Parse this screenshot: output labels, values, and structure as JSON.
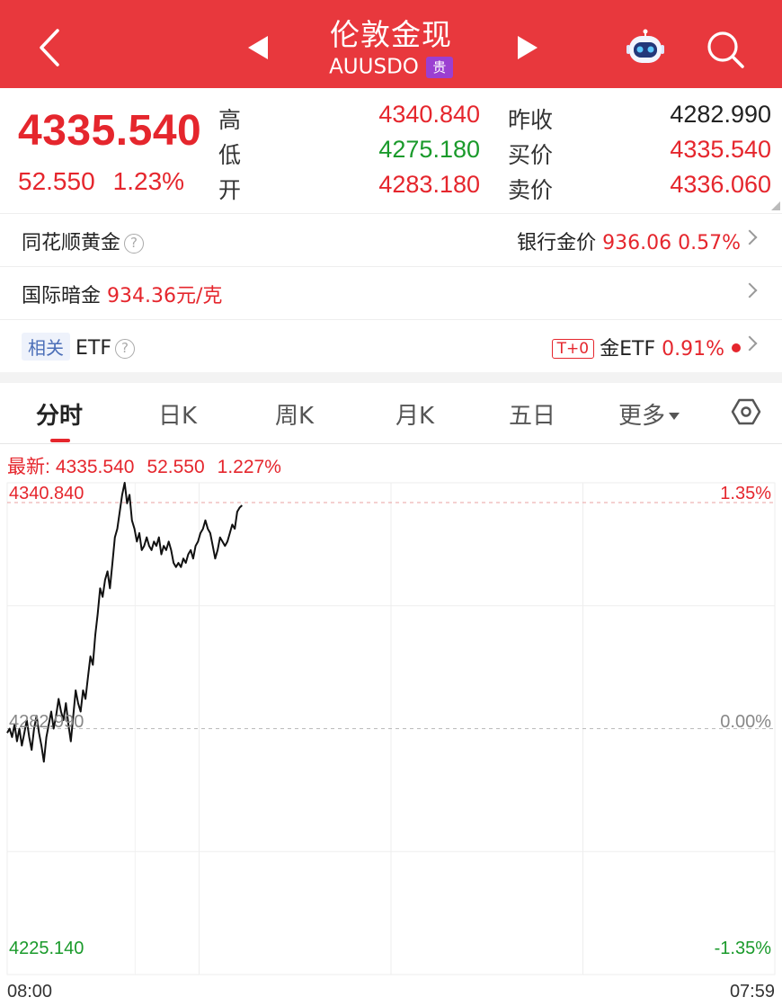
{
  "header": {
    "title": "伦敦金现",
    "code": "AUUSDO",
    "badge": "贵",
    "bg_color": "#e8383d",
    "icons": [
      "back-arrow-icon",
      "prev-triangle-icon",
      "next-triangle-icon",
      "robot-assistant-icon",
      "search-icon"
    ]
  },
  "quote": {
    "price": "4335.540",
    "change": "52.550",
    "change_pct": "1.23%",
    "high_label": "高",
    "high": "4340.840",
    "low_label": "低",
    "low": "4275.180",
    "open_label": "开",
    "open": "4283.180",
    "prev_close_label": "昨收",
    "prev_close": "4282.990",
    "bid_label": "买价",
    "bid": "4335.540",
    "ask_label": "卖价",
    "ask": "4336.060"
  },
  "rows": {
    "ths_gold": "同花顺黄金",
    "bank_gold_label": "银行金价",
    "bank_gold_value": "936.06",
    "bank_gold_pct": "0.57%",
    "intl_gold_label": "国际暗金",
    "intl_gold_value": "934.36元/克",
    "related_tag": "相关",
    "etf_label": "ETF",
    "t0_tag": "T+0",
    "gold_etf_label": "金ETF",
    "gold_etf_pct": "0.91%"
  },
  "tabs": {
    "items": [
      "分时",
      "日K",
      "周K",
      "月K",
      "五日",
      "更多"
    ],
    "active": "分时"
  },
  "latest": {
    "label": "最新:",
    "price": "4335.540",
    "change": "52.550",
    "pct": "1.227%"
  },
  "chart_data": {
    "type": "line",
    "title": "",
    "y_left_ticks": [
      "4340.840",
      "4282.990",
      "4225.140"
    ],
    "y_right_ticks": [
      "1.35%",
      "0.00%",
      "-1.35%"
    ],
    "x_ticks": [
      "08:00",
      "07:59"
    ],
    "prev_close": 4282.99,
    "ylim": [
      4225.14,
      4340.84
    ],
    "line_color": "#111111",
    "series": [
      {
        "values": [
          4282,
          4283,
          4281,
          4284,
          4280,
          4283,
          4279,
          4282,
          4285,
          4281,
          4278,
          4283,
          4286,
          4282,
          4279,
          4275.2,
          4281,
          4284,
          4287,
          4283,
          4286,
          4290,
          4287,
          4285,
          4289,
          4284,
          4280,
          4286,
          4292,
          4289,
          4287,
          4292,
          4290,
          4295,
          4300,
          4298,
          4305,
          4310,
          4316,
          4314,
          4318,
          4320,
          4316,
          4322,
          4328,
          4330,
          4334,
          4338,
          4340.84,
          4336,
          4338,
          4332,
          4330,
          4327,
          4329,
          4325,
          4326,
          4328,
          4326,
          4325,
          4327,
          4326,
          4328,
          4324,
          4326,
          4325,
          4327,
          4325,
          4322,
          4321,
          4322,
          4321,
          4323,
          4322,
          4324,
          4325,
          4323,
          4326,
          4327,
          4329,
          4330,
          4332,
          4330,
          4329,
          4326,
          4323,
          4325,
          4328,
          4327,
          4326,
          4327,
          4329,
          4331,
          4330,
          4334,
          4335,
          4335.54
        ]
      }
    ]
  }
}
